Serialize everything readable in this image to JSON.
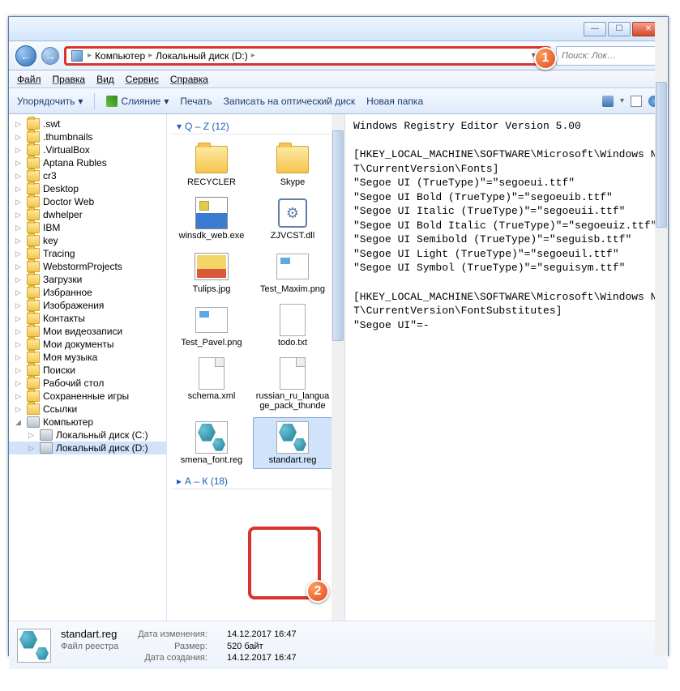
{
  "titlebar": {
    "min": "—",
    "max": "☐",
    "close": "✕"
  },
  "nav": {
    "back": "←",
    "fwd": "→"
  },
  "breadcrumb": {
    "root": "Компьютер",
    "path": "Локальный диск (D:)",
    "sep": "▸",
    "refresh": "↻",
    "dd": "▾"
  },
  "search": {
    "placeholder": "Поиск: Лок…"
  },
  "callouts": {
    "c1": "1",
    "c2": "2"
  },
  "menu": {
    "file": "Файл",
    "edit": "Правка",
    "view": "Вид",
    "service": "Сервис",
    "help": "Справка"
  },
  "toolbar": {
    "organize": "Упорядочить",
    "merge": "Слияние",
    "print": "Печать",
    "burn": "Записать на оптический диск",
    "newfolder": "Новая папка",
    "dd": "▾"
  },
  "tree": {
    "items": [
      {
        "t": ".swt",
        "k": "f"
      },
      {
        "t": ".thumbnails",
        "k": "f"
      },
      {
        "t": ".VirtualBox",
        "k": "f"
      },
      {
        "t": "Aptana Rubles",
        "k": "f"
      },
      {
        "t": "cr3",
        "k": "f"
      },
      {
        "t": "Desktop",
        "k": "f"
      },
      {
        "t": "Doctor Web",
        "k": "f"
      },
      {
        "t": "dwhelper",
        "k": "f"
      },
      {
        "t": "IBM",
        "k": "f"
      },
      {
        "t": "key",
        "k": "f"
      },
      {
        "t": "Tracing",
        "k": "f"
      },
      {
        "t": "WebstormProjects",
        "k": "f"
      },
      {
        "t": "Загрузки",
        "k": "f"
      },
      {
        "t": "Избранное",
        "k": "f"
      },
      {
        "t": "Изображения",
        "k": "f"
      },
      {
        "t": "Контакты",
        "k": "f"
      },
      {
        "t": "Мои видеозаписи",
        "k": "f"
      },
      {
        "t": "Мои документы",
        "k": "f"
      },
      {
        "t": "Моя музыка",
        "k": "f"
      },
      {
        "t": "Поиски",
        "k": "f"
      },
      {
        "t": "Рабочий стол",
        "k": "f"
      },
      {
        "t": "Сохраненные игры",
        "k": "f"
      },
      {
        "t": "Ссылки",
        "k": "f"
      }
    ],
    "computer": "Компьютер",
    "drives": [
      {
        "t": "Локальный диск (C:)",
        "sel": false
      },
      {
        "t": "Локальный диск (D:)",
        "sel": true
      }
    ]
  },
  "groups": {
    "g1": {
      "title": "Q – Z (12)",
      "exp": "▾"
    },
    "g2": {
      "title": "А – К (18)",
      "exp": "▸"
    }
  },
  "files": [
    {
      "n": "RECYCLER",
      "ic": "folder"
    },
    {
      "n": "Skype",
      "ic": "folder"
    },
    {
      "n": "winsdk_web.exe",
      "ic": "exe"
    },
    {
      "n": "ZJVCST.dll",
      "ic": "dll"
    },
    {
      "n": "Tulips.jpg",
      "ic": "img"
    },
    {
      "n": "Test_Maxim.png",
      "ic": "img2"
    },
    {
      "n": "Test_Pavel.png",
      "ic": "img2"
    },
    {
      "n": "todo.txt",
      "ic": "txt"
    },
    {
      "n": "schema.xml",
      "ic": "doc"
    },
    {
      "n": "russian_ru_language_pack_thunde",
      "ic": "doc"
    },
    {
      "n": "smena_font.reg",
      "ic": "reg"
    },
    {
      "n": "standart.reg",
      "ic": "reg",
      "sel": true
    }
  ],
  "preview": "Windows Registry Editor Version 5.00\n\n[HKEY_LOCAL_MACHINE\\SOFTWARE\\Microsoft\\Windows NT\\CurrentVersion\\Fonts]\n\"Segoe UI (TrueType)\"=\"segoeui.ttf\"\n\"Segoe UI Bold (TrueType)\"=\"segoeuib.ttf\"\n\"Segoe UI Italic (TrueType)\"=\"segoeuii.ttf\"\n\"Segoe UI Bold Italic (TrueType)\"=\"segoeuiz.ttf\"\n\"Segoe UI Semibold (TrueType)\"=\"seguisb.ttf\"\n\"Segoe UI Light (TrueType)\"=\"segoeuil.ttf\"\n\"Segoe UI Symbol (TrueType)\"=\"seguisym.ttf\"\n\n[HKEY_LOCAL_MACHINE\\SOFTWARE\\Microsoft\\Windows NT\\CurrentVersion\\FontSubstitutes]\n\"Segoe UI\"=-",
  "details": {
    "name": "standart.reg",
    "type": "Файл реестра",
    "k_mod": "Дата изменения:",
    "v_mod": "14.12.2017 16:47",
    "k_size": "Размер:",
    "v_size": "520 байт",
    "k_created": "Дата создания:",
    "v_created": "14.12.2017 16:47"
  }
}
